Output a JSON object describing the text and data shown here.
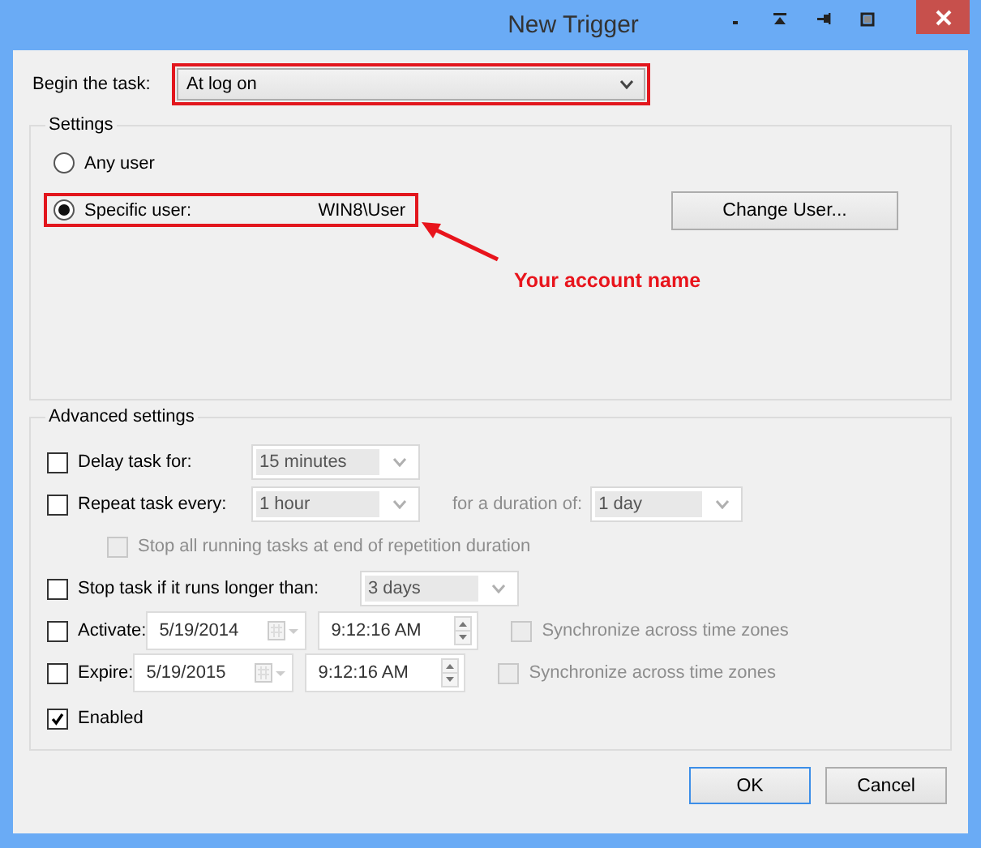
{
  "window": {
    "title": "New Trigger"
  },
  "begin_task": {
    "label": "Begin the task:",
    "value": "At log on",
    "highlighted": true
  },
  "settings": {
    "title": "Settings",
    "options": [
      {
        "label": "Any user",
        "selected": false
      },
      {
        "label": "Specific user:",
        "selected": true,
        "value": "WIN8\\User",
        "highlighted": true
      }
    ],
    "change_user_button": "Change User...",
    "annotation": "Your account name"
  },
  "advanced": {
    "title": "Advanced settings",
    "rows": [
      {
        "kind": "dropdown",
        "label": "Delay task for:",
        "checked": false,
        "disabled": false,
        "value": "15 minutes"
      },
      {
        "kind": "repeat",
        "label": "Repeat task every:",
        "checked": false,
        "disabled": false,
        "value": "1 hour",
        "duration_label": "for a duration of:",
        "duration_value": "1 day"
      },
      {
        "kind": "sub",
        "label": "Stop all running tasks at end of repetition duration",
        "checked": false,
        "disabled": true
      },
      {
        "kind": "dropdown",
        "label": "Stop task if it runs longer than:",
        "checked": false,
        "disabled": false,
        "value": "3 days"
      },
      {
        "kind": "datetime",
        "label": "Activate:",
        "checked": false,
        "disabled": false,
        "date": "5/19/2014",
        "time": "9:12:16 AM",
        "sync_label": "Synchronize across time zones",
        "sync_checked": false
      },
      {
        "kind": "datetime",
        "label": "Expire:",
        "checked": false,
        "disabled": false,
        "date": "5/19/2015",
        "time": "9:12:16 AM",
        "sync_label": "Synchronize across time zones",
        "sync_checked": false
      },
      {
        "kind": "plain",
        "label": "Enabled",
        "checked": true,
        "disabled": false
      }
    ]
  },
  "buttons": [
    {
      "label": "OK",
      "selected": true
    },
    {
      "label": "Cancel",
      "selected": false
    }
  ]
}
